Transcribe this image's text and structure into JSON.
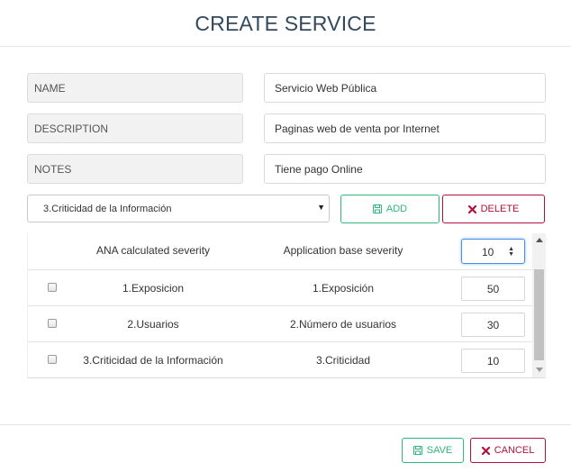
{
  "dialog": {
    "title": "CREATE SERVICE"
  },
  "fields": {
    "name": {
      "label": "NAME",
      "value": "Servicio Web Pública"
    },
    "description": {
      "label": "DESCRIPTION",
      "value": "Paginas web de venta por Internet"
    },
    "notes": {
      "label": "NOTES",
      "value": "Tiene pago Online"
    }
  },
  "selector": {
    "selected": "3.Criticidad de la Información"
  },
  "buttons": {
    "add": "ADD",
    "delete": "DELETE",
    "save": "SAVE",
    "cancel": "CANCEL"
  },
  "table": {
    "headers": {
      "ana": "ANA calculated severity",
      "app": "Application base severity",
      "severity_value": "10"
    },
    "rows": [
      {
        "ana": "1.Exposicion",
        "app": "1.Exposición",
        "value": "50"
      },
      {
        "ana": "2.Usuarios",
        "app": "2.Número de usuarios",
        "value": "30"
      },
      {
        "ana": "3.Criticidad de la Información",
        "app": "3.Criticidad",
        "value": "10"
      }
    ]
  },
  "colors": {
    "title": "#34495e",
    "success": "#2eb87a",
    "danger": "#b0123a",
    "focus": "#4a90e2"
  },
  "icons": {
    "add": "save-disk-icon",
    "delete": "x-mark-icon",
    "save": "save-disk-icon",
    "cancel": "x-mark-icon"
  }
}
